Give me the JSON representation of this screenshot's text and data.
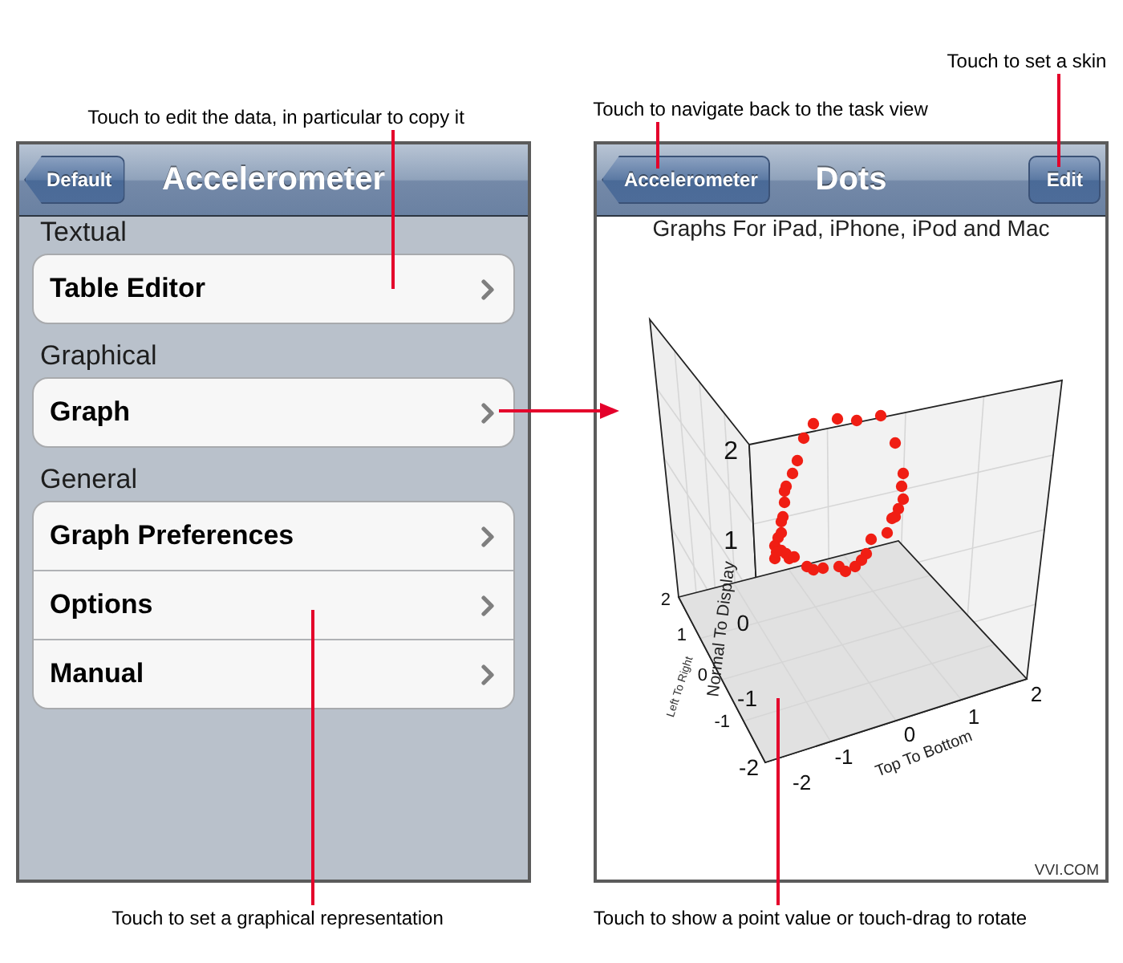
{
  "callouts": [
    {
      "text": "Touch to set a skin"
    },
    {
      "text": "Touch to navigate back to the task view"
    },
    {
      "text": "Touch to edit the data, in particular to copy it"
    },
    {
      "text": "Touch to set a graphical representation"
    },
    {
      "text": "Touch to show a point value or touch-drag to rotate"
    }
  ],
  "left_screen": {
    "nav_bar": {
      "back_button": "Default",
      "title": "Accelerometer"
    },
    "sections": [
      {
        "header": "Textual",
        "items": [
          {
            "label": "Table Editor"
          }
        ]
      },
      {
        "header": "Graphical",
        "items": [
          {
            "label": "Graph"
          }
        ]
      },
      {
        "header": "General",
        "items": [
          {
            "label": "Graph Preferences"
          },
          {
            "label": "Options"
          },
          {
            "label": "Manual"
          }
        ]
      }
    ]
  },
  "right_screen": {
    "nav_bar": {
      "back_button": "Accelerometer",
      "title": "Dots",
      "right_button": "Edit"
    },
    "subtitle": "Graphs For iPad, iPhone, iPod and Mac",
    "plot": {
      "vertical_axis": {
        "label": "Normal To Display",
        "ticks": [
          "2",
          "1",
          "0",
          "-1",
          "-2"
        ]
      },
      "depth_axis": {
        "label": "Left To Right",
        "ticks": [
          "2",
          "1",
          "0",
          "-1"
        ]
      },
      "horizontal_axis": {
        "label": "Top To Bottom",
        "ticks": [
          "-2",
          "-1",
          "0",
          "1",
          "2"
        ]
      }
    },
    "footer": "VVI.COM"
  }
}
